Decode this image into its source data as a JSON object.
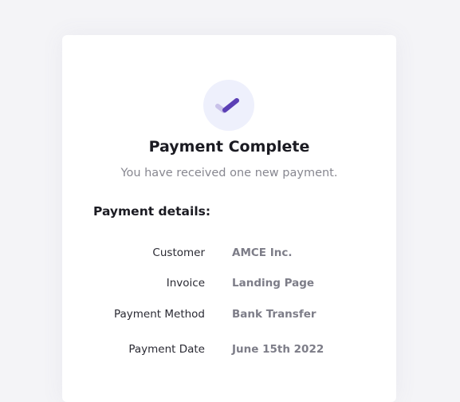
{
  "card": {
    "title": "Payment Complete",
    "subtitle": "You have received one new payment.",
    "details_heading": "Payment details:",
    "icon": "check-icon",
    "colors": {
      "accent": "#5b3fb5",
      "accent_light": "#c9c2e9",
      "badge_bg": "#eef0fc"
    }
  },
  "details": [
    {
      "label": "Customer",
      "value": "AMCE Inc."
    },
    {
      "label": "Invoice",
      "value": "Landing Page"
    },
    {
      "label": "Payment Method",
      "value": "Bank Transfer"
    },
    {
      "label": "Payment Date",
      "value": "June 15th 2022"
    }
  ]
}
